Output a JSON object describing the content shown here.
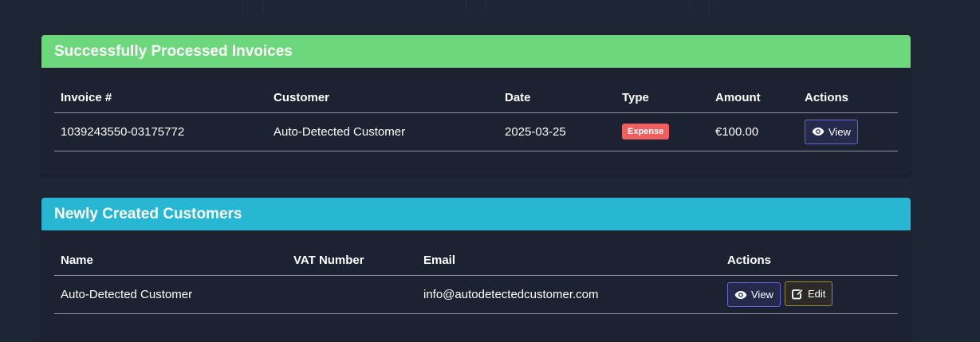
{
  "colors": {
    "success_header": "#6dd77c",
    "info_header": "#27b7d3",
    "badge_expense": "#f05f5f",
    "background": "#1e2535"
  },
  "invoices_card": {
    "title": "Successfully Processed Invoices",
    "columns": [
      "Invoice #",
      "Customer",
      "Date",
      "Type",
      "Amount",
      "Actions"
    ],
    "rows": [
      {
        "invoice": "1039243550-03175772",
        "customer": "Auto-Detected Customer",
        "date": "2025-03-25",
        "type": "Expense",
        "amount": "€100.00",
        "view_label": "View"
      }
    ]
  },
  "customers_card": {
    "title": "Newly Created Customers",
    "columns": [
      "Name",
      "VAT Number",
      "Email",
      "Actions"
    ],
    "rows": [
      {
        "name": "Auto-Detected Customer",
        "vat": "",
        "email": "info@autodetectedcustomer.com",
        "view_label": "View",
        "edit_label": "Edit"
      }
    ]
  },
  "icons": {
    "view": "eye-icon",
    "edit": "edit-icon"
  }
}
